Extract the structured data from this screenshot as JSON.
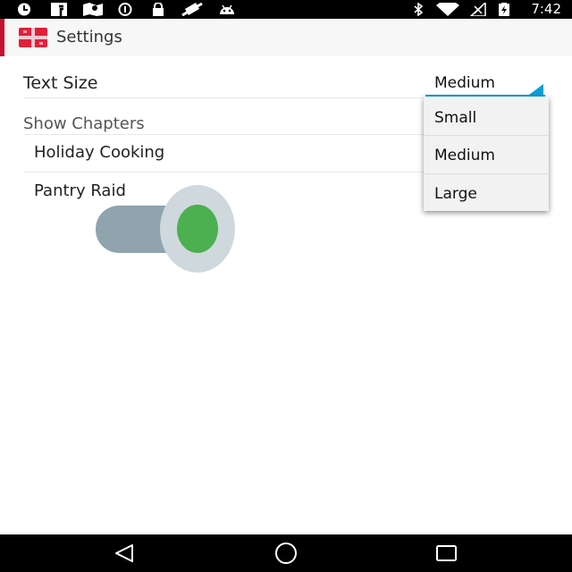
{
  "status_bar": {
    "time": "7:42",
    "icons": [
      "clock-icon",
      "facebook-icon",
      "maps-icon",
      "info-icon",
      "lock-icon",
      "satellite-icon",
      "android-icon",
      "bluetooth-icon",
      "wifi-icon",
      "signal-icon",
      "battery-icon"
    ]
  },
  "action_bar": {
    "title": "Settings",
    "accent_color": "#c8102e"
  },
  "preferences": {
    "text_size": {
      "label": "Text Size",
      "selected": "Medium",
      "options": [
        "Small",
        "Medium",
        "Large"
      ]
    },
    "category": "Show Chapters",
    "chapters": [
      {
        "label": "Holiday Cooking"
      },
      {
        "label": "Pantry Raid",
        "switch_on": true
      }
    ]
  },
  "colors": {
    "spinner_accent": "#0a9fd8",
    "switch_on": "#4caf50"
  },
  "nav_bar": {
    "icons": [
      "back-icon",
      "home-icon",
      "recents-icon"
    ]
  }
}
